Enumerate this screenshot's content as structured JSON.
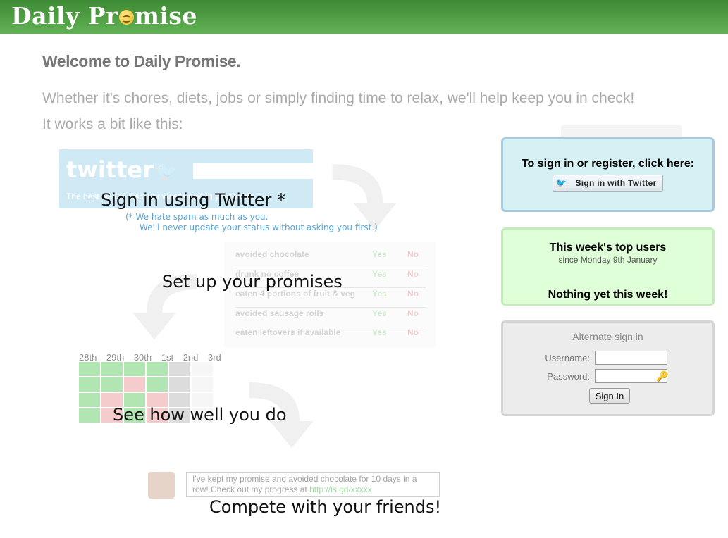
{
  "header": {
    "logo_left": "Daily Pr",
    "logo_right": "mise"
  },
  "intro": {
    "welcome": "Welcome to Daily Promise.",
    "line1": "Whether it's chores, diets, jobs or simply finding time to relax, we'll help keep you in check!",
    "line2": "It works a bit like this:"
  },
  "steps": {
    "twitter": "Sign in using Twitter *",
    "note1": "(* We hate spam as much as you.",
    "note2": "We'll never update your status without asking you first.)",
    "promises": "Set up your promises",
    "progress": "See how well you do",
    "compete": "Compete with your friends!"
  },
  "illustrations": {
    "twitter_word": "twitter",
    "twitter_tagline": "The best way to discover what's new in your world.",
    "promise_rows": [
      {
        "label": "avoided chocolate",
        "yes": "Yes",
        "no": "No"
      },
      {
        "label": "drunk no coffee",
        "yes": "Yes",
        "no": "No"
      },
      {
        "label": "eaten 4 portions of fruit & veg",
        "yes": "Yes",
        "no": "No"
      },
      {
        "label": "avoided sausage rolls",
        "yes": "Yes",
        "no": "No"
      },
      {
        "label": "eaten leftovers if available",
        "yes": "Yes",
        "no": "No"
      }
    ],
    "calendar_days": "28th 29th 30th 1st 2nd 3rd",
    "tweet_text": "I've kept my promise and avoided chocolate for 10 days in a row! Check out my progress at",
    "tweet_link": "http://is.gd/xxxxx"
  },
  "signin_panel": {
    "title": "To sign in or register, click here:",
    "button": "Sign in with Twitter"
  },
  "top_users": {
    "title": "This week's top users",
    "since": "since Monday 9th January",
    "empty": "Nothing yet this week!"
  },
  "alt_signin": {
    "title": "Alternate sign in",
    "username_label": "Username:",
    "username_value": "",
    "password_label": "Password:",
    "password_value": "",
    "submit": "Sign In"
  },
  "colors": {
    "header_green": "#4d9c41",
    "signin_bg": "#d5f1f4",
    "topusers_bg": "#dfffd9",
    "alt_bg": "#ececec"
  }
}
